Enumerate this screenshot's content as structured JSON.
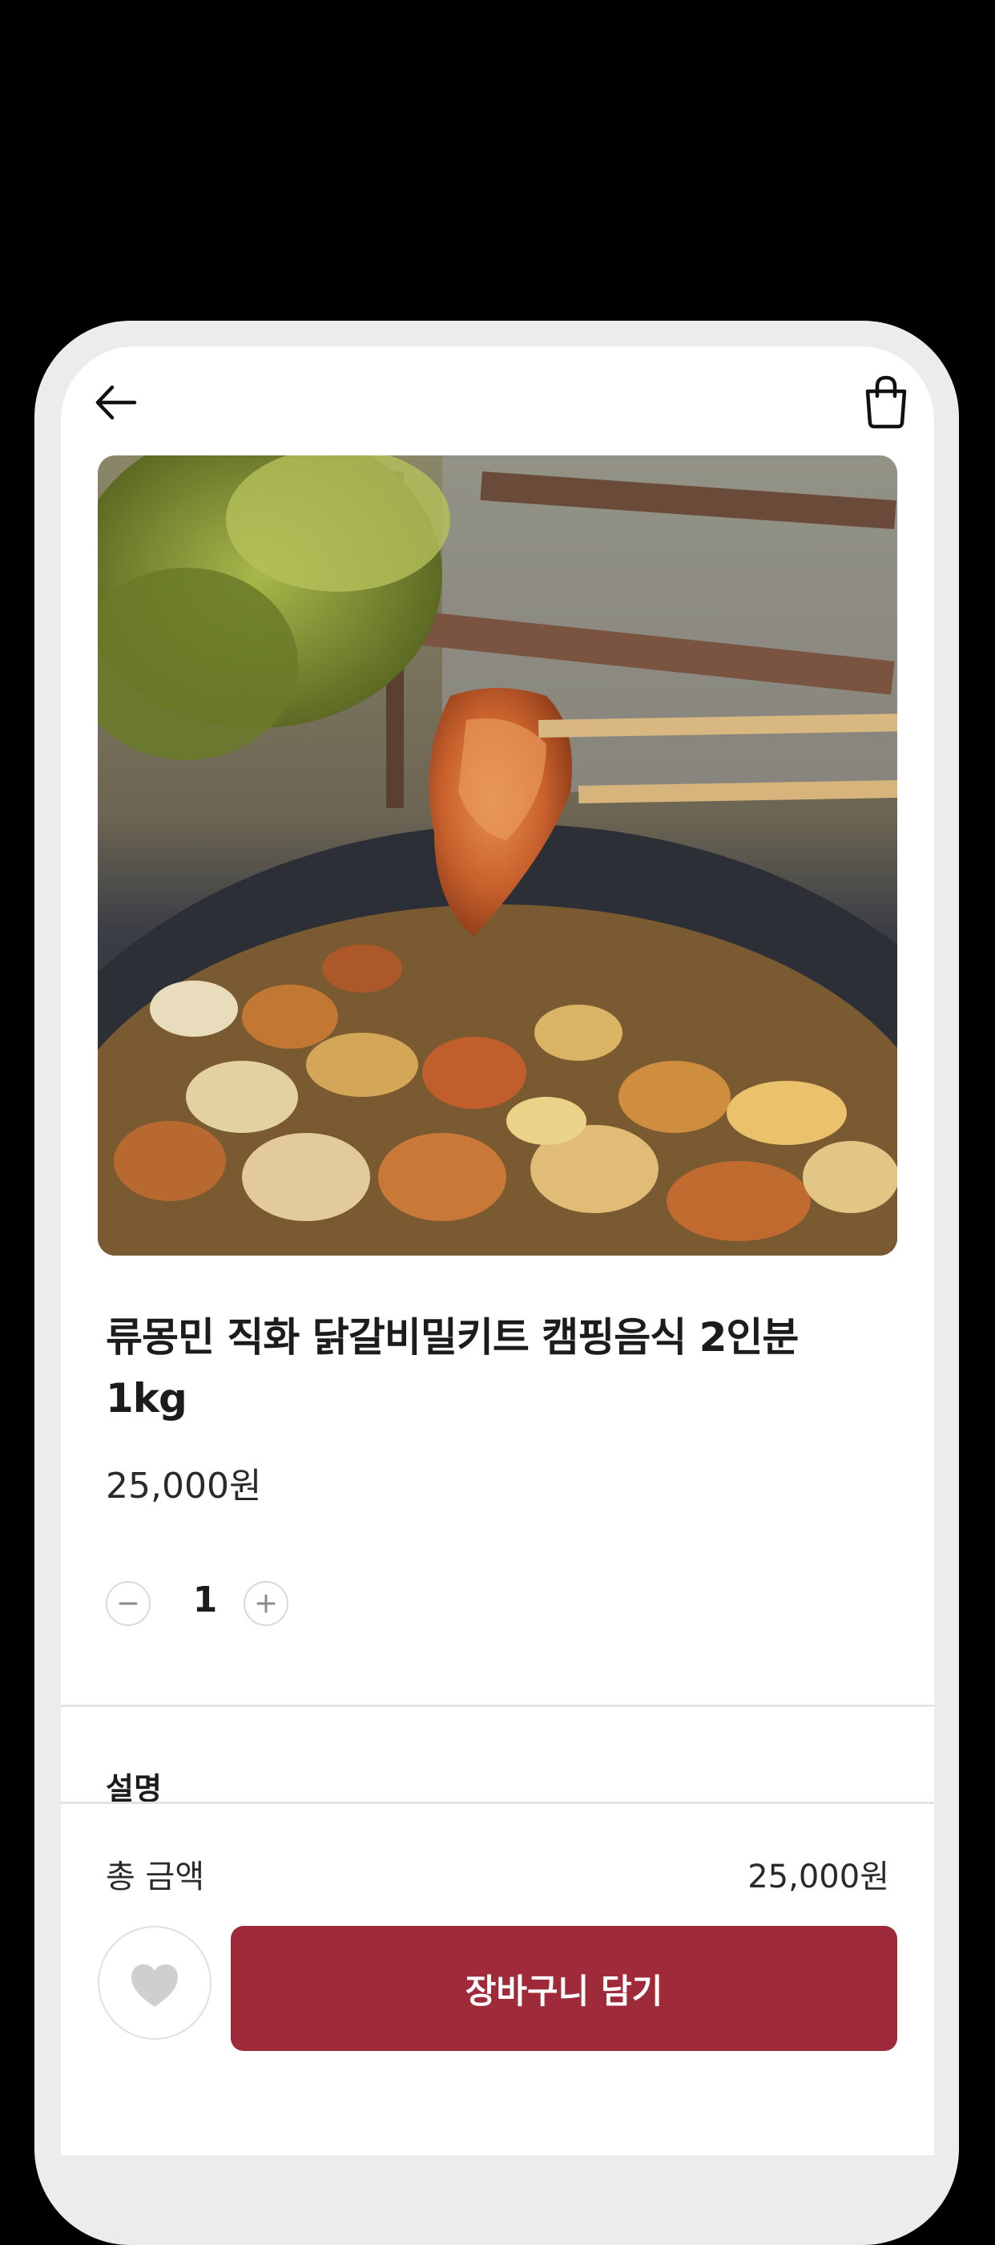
{
  "product": {
    "title": "류몽민 직화 닭갈비밀키트 캠핑음식 2인분 1kg",
    "price": "25,000원",
    "image_icon": "grilled-chicken-photo"
  },
  "quantity": {
    "value": "1",
    "minus_icon": "minus-icon",
    "plus_icon": "plus-icon"
  },
  "section": {
    "description_label": "설명"
  },
  "footer": {
    "total_label": "총 금액",
    "total_value": "25,000원",
    "add_to_cart_label": "장바구니 담기",
    "heart_icon": "heart-icon"
  },
  "colors": {
    "accent": "#9e2a3a",
    "background": "#ffffff",
    "frame": "#ececec"
  }
}
